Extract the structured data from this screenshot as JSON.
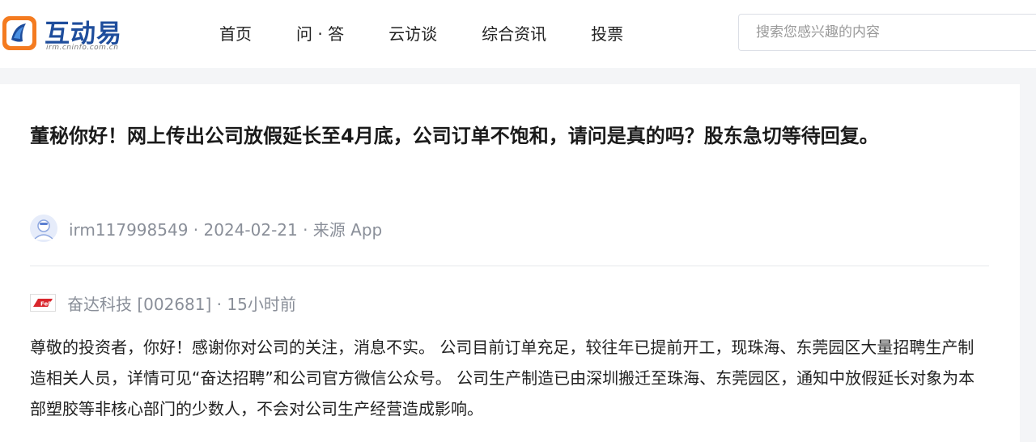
{
  "header": {
    "logo_text": "互动易",
    "logo_sub": "irm.cninfo.com.cn",
    "nav": [
      "首页",
      "问 · 答",
      "云访谈",
      "综合资讯",
      "投票"
    ],
    "search_placeholder": "搜索您感兴趣的内容"
  },
  "question": {
    "text": "董秘你好！网上传出公司放假延长至4月底，公司订单不饱和，请问是真的吗？股东急切等待回复。",
    "meta": "irm117998549 · 2024-02-21 · 来源 App"
  },
  "answer": {
    "company_logo_text": "FeD",
    "meta": "奋达科技 [002681] · 15小时前",
    "text": "尊敬的投资者，你好！感谢你对公司的关注，消息不实。 公司目前订单充足，较往年已提前开工，现珠海、东莞园区大量招聘生产制造相关人员，详情可见“奋达招聘”和公司官方微信公众号。 公司生产制造已由深圳搬迁至珠海、东莞园区，通知中放假延长对象为本部塑胶等非核心部门的少数人，不会对公司生产经营造成影响。"
  },
  "colors": {
    "brand_blue": "#1e4d9c",
    "brand_orange": "#f47b20",
    "meta_gray": "#8a8f99",
    "page_bg": "#f4f5f7"
  },
  "icons": {
    "logo": "cninfo-logo-icon",
    "avatar": "user-avatar-icon",
    "company": "company-logo-icon"
  }
}
